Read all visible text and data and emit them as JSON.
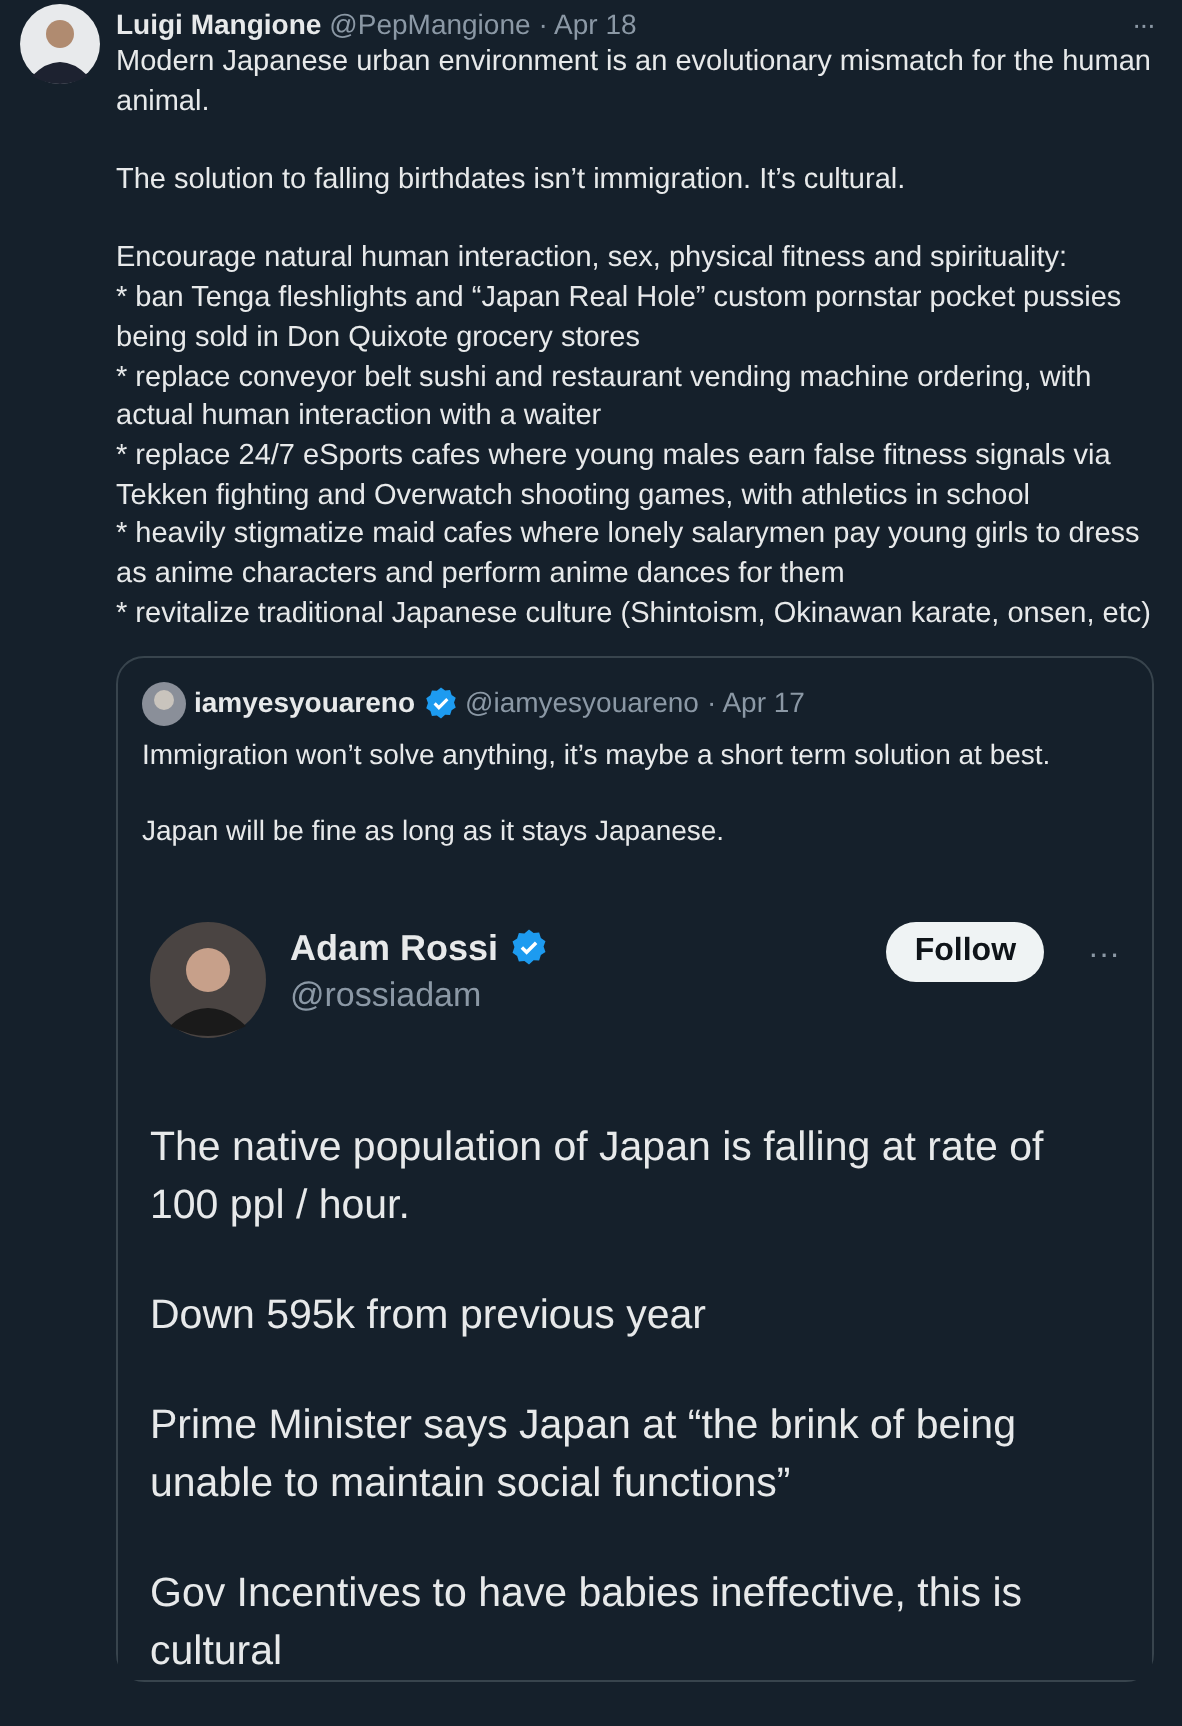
{
  "tweet": {
    "name": "Luigi Mangione",
    "handle": "@PepMangione",
    "date": "· Apr 18",
    "more": "···",
    "paragraphs": [
      "Modern Japanese urban environment is an evolutionary mismatch for the human animal.",
      "The solution to falling birthdates isn’t immigration. It’s cultural."
    ],
    "list_intro": "Encourage natural human interaction, sex, physical fitness and spirituality:",
    "bullets": [
      "* ban Tenga fleshlights and “Japan Real Hole” custom pornstar pocket pussies being sold in Don Quixote grocery stores",
      "* replace conveyor belt sushi and restaurant vending machine ordering, with actual human interaction with a waiter",
      "* replace 24/7 eSports cafes where young males earn false fitness signals via Tekken fighting and Overwatch shooting games, with athletics in school",
      "* heavily stigmatize maid cafes where lonely salarymen pay young girls to dress as anime characters and perform anime dances for them",
      "* revitalize traditional Japanese culture (Shintoism, Okinawan karate, onsen, etc)"
    ]
  },
  "quote": {
    "name": "iamyesyouareno",
    "verified": true,
    "handle": "@iamyesyouareno",
    "date": "· Apr 17",
    "paragraphs": [
      "Immigration won’t solve anything, it’s maybe a short term solution at best.",
      "Japan will be fine as long as it stays Japanese."
    ],
    "image": {
      "name": "Adam Rossi",
      "verified": true,
      "handle": "@rossiadam",
      "follow": "Follow",
      "more": "···",
      "paragraphs": [
        "The native population of Japan is falling at rate of 100 ppl / hour.",
        "Down 595k from previous year",
        "Prime Minister says Japan at “the brink of being unable to maintain social functions”",
        "Gov Incentives to have babies ineffective, this is cultural"
      ]
    }
  }
}
